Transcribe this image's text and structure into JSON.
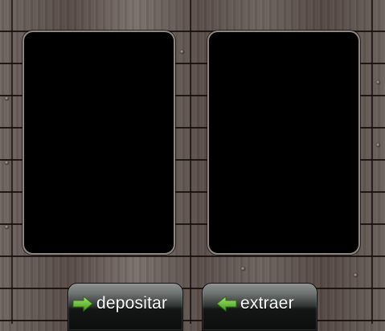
{
  "buttons": {
    "deposit": {
      "label": "depositar",
      "icon": "arrow-right-icon"
    },
    "withdraw": {
      "label": "extraer",
      "icon": "arrow-left-icon"
    }
  },
  "colors": {
    "slot_fill": "#000000",
    "slot_border": "#8e8682",
    "arrow_green": "#6cc43a",
    "button_text": "#ffffff"
  }
}
